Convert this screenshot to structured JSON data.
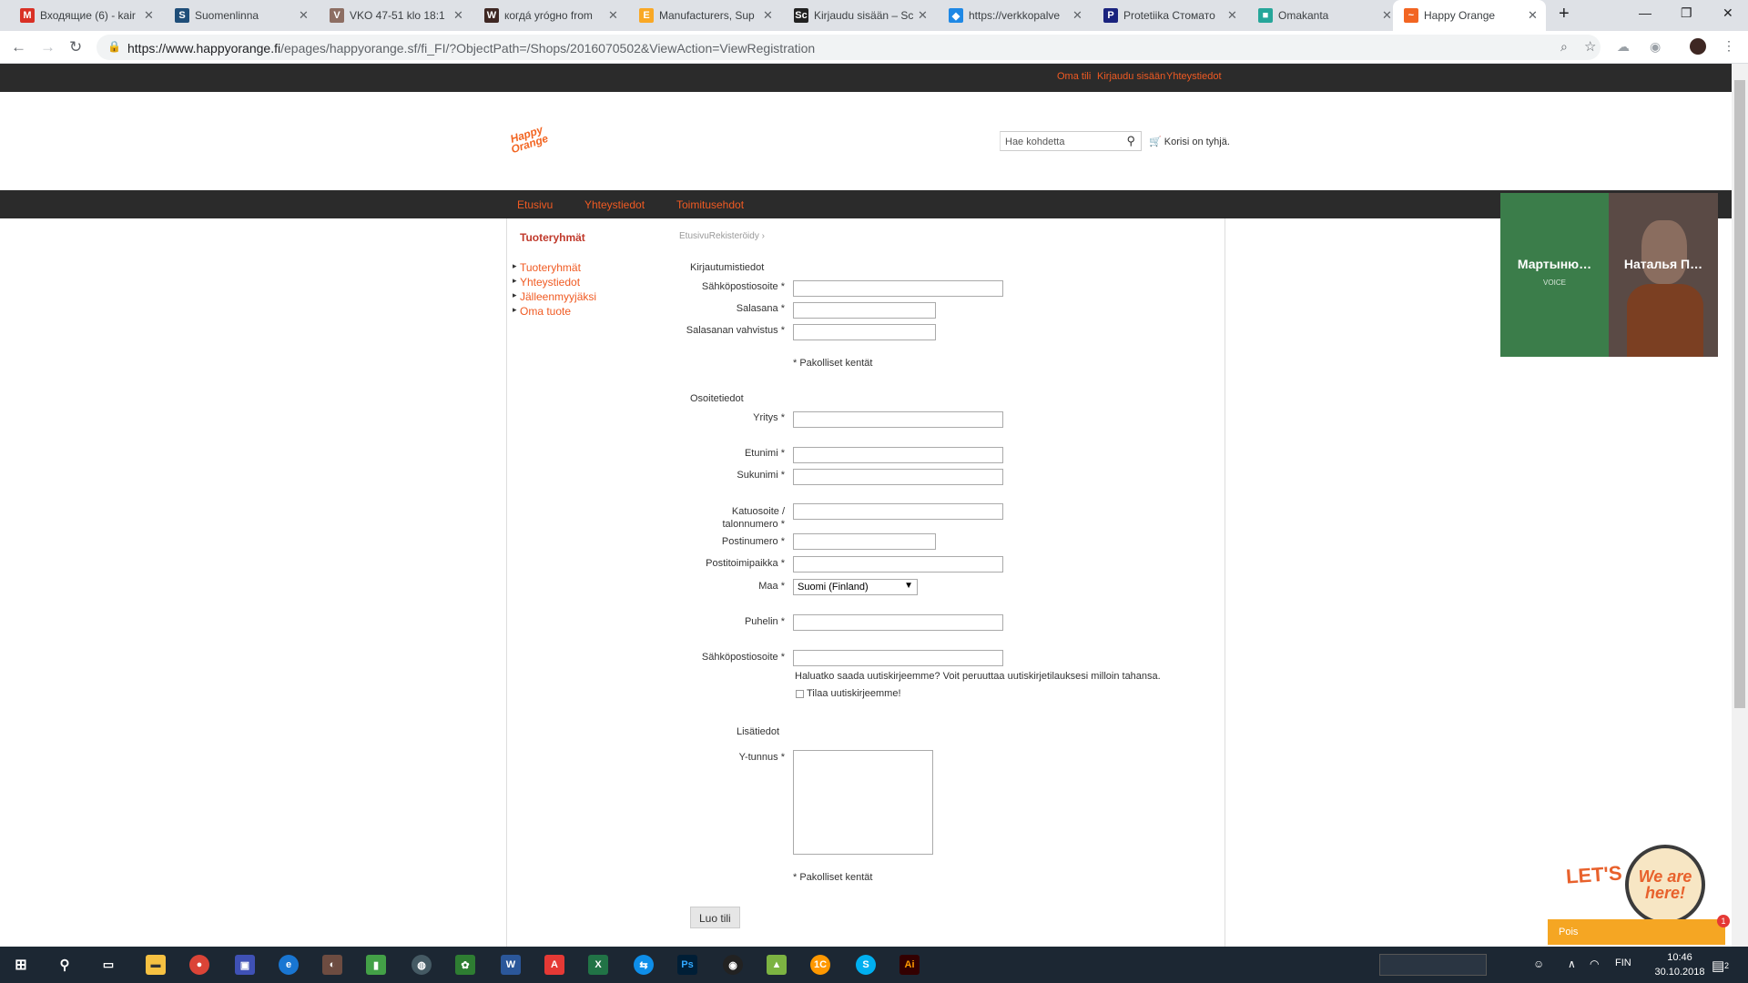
{
  "browser": {
    "tabs": [
      {
        "title": "Входящие (6) - kair",
        "icon": "gmail-icon",
        "color": "#d93025",
        "glyph": "M"
      },
      {
        "title": "Suomenlinna",
        "icon": "suomenlinna-icon",
        "color": "#1f4e79",
        "glyph": "S"
      },
      {
        "title": "VKO 47-51 klo 18:1",
        "icon": "vko-icon",
        "color": "#8d6e63",
        "glyph": "V"
      },
      {
        "title": "когдá yrógно from",
        "icon": "wiktionary-icon",
        "color": "#3e2723",
        "glyph": "W"
      },
      {
        "title": "Manufacturers, Sup",
        "icon": "alibaba-icon",
        "color": "#f9a825",
        "glyph": "E"
      },
      {
        "title": "Kirjaudu sisään – Sc",
        "icon": "sc-icon",
        "color": "#212121",
        "glyph": "Sc"
      },
      {
        "title": "https://verkkopalve",
        "icon": "diamond-icon",
        "color": "#1e88e5",
        "glyph": "◆"
      },
      {
        "title": "Protetiika Стомато",
        "icon": "protetiika-icon",
        "color": "#1a237e",
        "glyph": "P"
      },
      {
        "title": "Omakanta",
        "icon": "omakanta-icon",
        "color": "#26a69a",
        "glyph": "■"
      },
      {
        "title": "Happy Orange",
        "icon": "happy-orange-icon",
        "color": "#f26522",
        "glyph": "~"
      }
    ],
    "url_host": "https://www.happyorange.fi",
    "url_path": "/epages/happyorange.sf/fi_FI/?ObjectPath=/Shops/2016070502&ViewAction=ViewRegistration"
  },
  "site": {
    "top_links": [
      "Oma tili",
      "Kirjaudu sisään",
      "Yhteystiedot"
    ],
    "logo_text": "Happy Orange",
    "search_placeholder": "Hae kohdetta",
    "cart_text": "Korisi on tyhjä.",
    "nav": [
      "Etusivu",
      "Yhteystiedot",
      "Toimitusehdot"
    ],
    "sidebar_title": "Tuoteryhmät",
    "sidebar_items": [
      "Tuoteryhmät",
      "Yhteystiedot",
      "Jälleenmyyjäksi",
      "Oma tuote"
    ],
    "breadcrumb": "EtusivuRekisteröidy",
    "sections": {
      "login": "Kirjautumistiedot",
      "address": "Osoitetiedot",
      "extra": "Lisätiedot"
    },
    "labels": {
      "email": "Sähköpostiosoite *",
      "password": "Salasana *",
      "password_confirm": "Salasanan vahvistus *",
      "company": "Yritys *",
      "firstname": "Etunimi *",
      "lastname": "Sukunimi *",
      "street_1": "Katuosoite /",
      "street_2": "talonnumero *",
      "zip": "Postinumero *",
      "city": "Postitoimipaikka *",
      "country": "Maa *",
      "phone": "Puhelin *",
      "email2": "Sähköpostiosoite *",
      "ytunnus": "Y-tunnus *"
    },
    "required_note": "* Pakolliset kentät",
    "country_value": "Suomi (Finland)",
    "newsletter_text": "Haluatko saada uutiskirjeemme? Voit peruuttaa uutiskirjetilauksesi milloin tahansa.",
    "newsletter_checkbox": "Tilaa uutiskirjeemme!",
    "newsletter_checked": false,
    "submit_label": "Luo tili"
  },
  "overlay": {
    "participants": [
      {
        "name": "Мартыню…",
        "sub": "VOICE"
      },
      {
        "name": "Наталья П…",
        "sub": ""
      }
    ],
    "chat_tagline": "LET'S CHAT!",
    "chat_bubble": "We are here!",
    "chat_bar": "Pois",
    "chat_badge": "1"
  },
  "taskbar": {
    "lang": "FIN",
    "time": "10:46",
    "date": "30.10.2018",
    "notifications": "2"
  }
}
